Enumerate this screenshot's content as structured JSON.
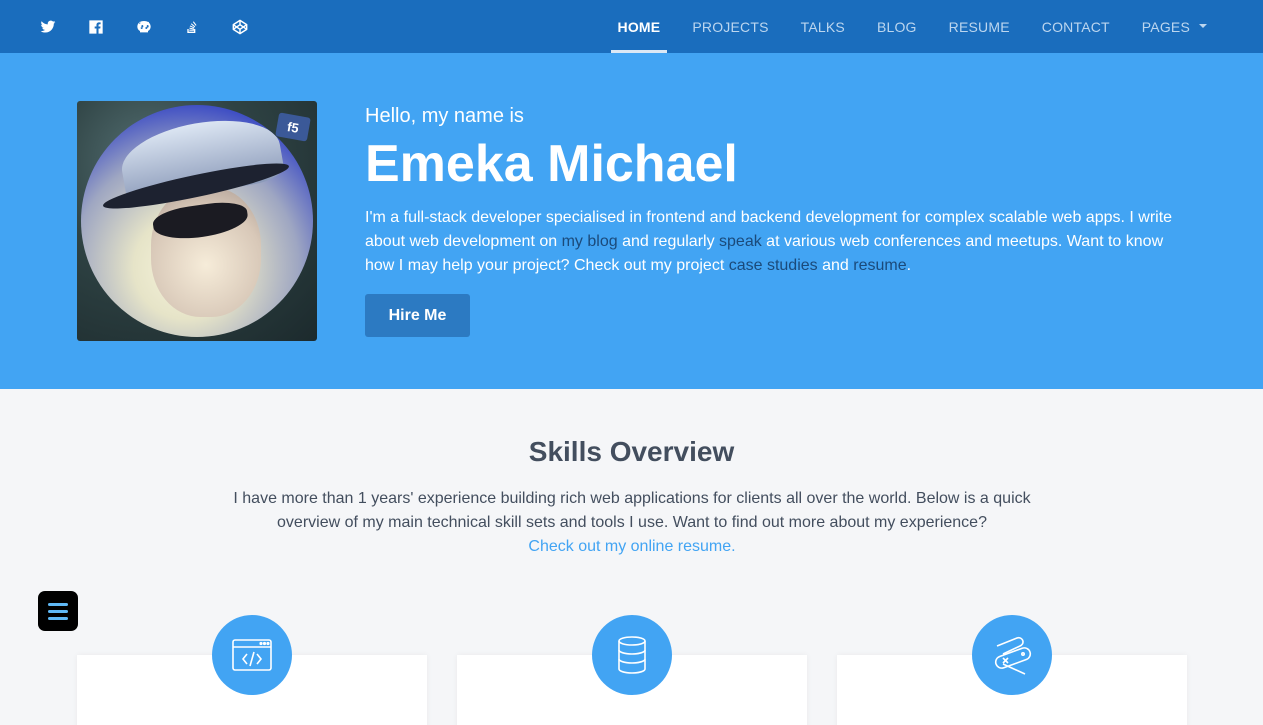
{
  "nav": {
    "social_icons": [
      "twitter-icon",
      "facebook-icon",
      "github-icon",
      "stack-overflow-icon",
      "codepen-icon"
    ],
    "links": [
      {
        "label": "HOME",
        "active": true
      },
      {
        "label": "PROJECTS",
        "active": false
      },
      {
        "label": "TALKS",
        "active": false
      },
      {
        "label": "BLOG",
        "active": false
      },
      {
        "label": "RESUME",
        "active": false
      },
      {
        "label": "CONTACT",
        "active": false
      },
      {
        "label": "PAGES",
        "active": false
      }
    ]
  },
  "hero": {
    "badge": "f5",
    "greeting": "Hello, my name is",
    "name": "Emeka Michael",
    "bio": {
      "part1": "I'm a full-stack developer specialised in frontend and backend development for complex scalable web apps. I write about web development on ",
      "link_blog": "my blog",
      "part2": " and regularly ",
      "link_speak": "speak",
      "part3": " at various web conferences and meetups. Want to know how I may help your project? Check out my project ",
      "link_case": "case studies",
      "part4": " and ",
      "link_resume": "resume",
      "part5": "."
    },
    "hire_button": "Hire Me"
  },
  "skills": {
    "title": "Skills Overview",
    "intro": "I have more than 1 years' experience building rich web applications for clients all over the world. Below is a quick overview of my main technical skill sets and tools I use. Want to find out more about my experience?",
    "link": "Check out my online resume."
  },
  "cards": [
    {
      "icon": "code-window-icon"
    },
    {
      "icon": "database-icon"
    },
    {
      "icon": "swiss-knife-icon"
    }
  ],
  "colors": {
    "navbar": "#1a6dbd",
    "hero": "#42a4f3",
    "accent": "#42a4f3",
    "button": "#2c7ac2"
  }
}
